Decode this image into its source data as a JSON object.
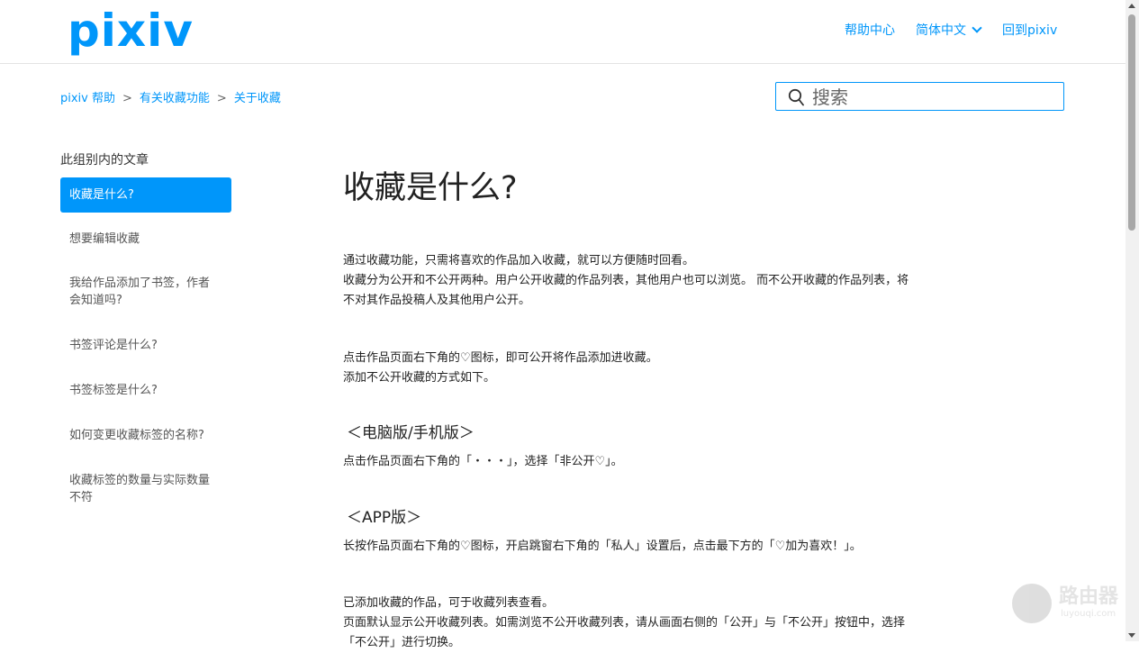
{
  "header": {
    "logo": "pixiv",
    "nav": {
      "help_center": "帮助中心",
      "language": "简体中文",
      "back": "回到pixiv"
    }
  },
  "breadcrumb": [
    "pixiv 帮助",
    "有关收藏功能",
    "关于收藏"
  ],
  "search": {
    "placeholder": "搜索",
    "icon": "search-icon"
  },
  "sidebar": {
    "title": "此组别内的文章",
    "items": [
      {
        "label": "收藏是什么?"
      },
      {
        "label": "想要编辑收藏"
      },
      {
        "label": "我给作品添加了书签，作者"
      },
      {
        "label": "会知道吗?"
      },
      {
        "label": "书签评论是什么?"
      },
      {
        "label": "书签标签是什么?"
      },
      {
        "label": "如何变更收藏标签的名称?"
      },
      {
        "label": "收藏标签的数量与实际数量"
      },
      {
        "label": "不符"
      }
    ]
  },
  "article": {
    "title": "收藏是什么?",
    "lines": [
      "通过收藏功能，只需将喜欢的作品加入收藏，就可以方便随时回看。",
      "收藏分为公开和不公开两种。用户公开收藏的作品列表，其他用户也可以浏览。 而不公开收藏的作品列表，将",
      "不对其作品投稿人及其他用户公开。",
      "点击作品页面右下角的♡图标，即可公开将作品添加进收藏。",
      "添加不公开收藏的方式如下。",
      "＜电脑版/手机版＞",
      "点击作品页面右下角的「・・・」，选择「非公开♡」。",
      "＜APP版＞",
      "长按作品页面右下角的♡图标，开启跳窗右下角的「私人」设置后，点击最下方的「♡加为喜欢！」。",
      "已添加收藏的作品，可于收藏列表查看。",
      "页面默认显示公开收藏列表。如需浏览不公开收藏列表，请从画面右侧的「公开」与「不公开」按钮中，选择",
      "「不公开」进行切换。"
    ]
  },
  "watermark": {
    "text": "路由器",
    "sub": "luyouqi.com"
  },
  "colors": {
    "accent": "#0096fa",
    "text": "#333333"
  }
}
